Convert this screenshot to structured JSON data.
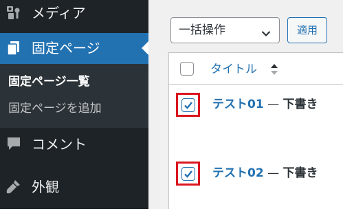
{
  "sidebar": {
    "items": [
      {
        "label": "メディア",
        "icon": "media-icon"
      },
      {
        "label": "固定ページ",
        "icon": "pages-icon",
        "active": true
      },
      {
        "label": "コメント",
        "icon": "comment-icon"
      },
      {
        "label": "外観",
        "icon": "appearance-icon"
      }
    ],
    "submenu": [
      {
        "label": "固定ページ一覧",
        "current": true
      },
      {
        "label": "固定ページを追加"
      }
    ],
    "colors": {
      "background": "#1d2327",
      "active": "#2271b1",
      "submenu_bg": "#2c3338"
    }
  },
  "toolbar": {
    "bulk_action_value": "一括操作",
    "apply_label": "適用"
  },
  "table": {
    "column_title": "タイトル",
    "rows": [
      {
        "title": "テスト01",
        "separator": " — ",
        "state": "下書き",
        "checked": true
      },
      {
        "title": "テスト02",
        "separator": " — ",
        "state": "下書き",
        "checked": true
      }
    ]
  },
  "colors": {
    "link": "#2271b1",
    "highlight_border": "#d9151e"
  }
}
